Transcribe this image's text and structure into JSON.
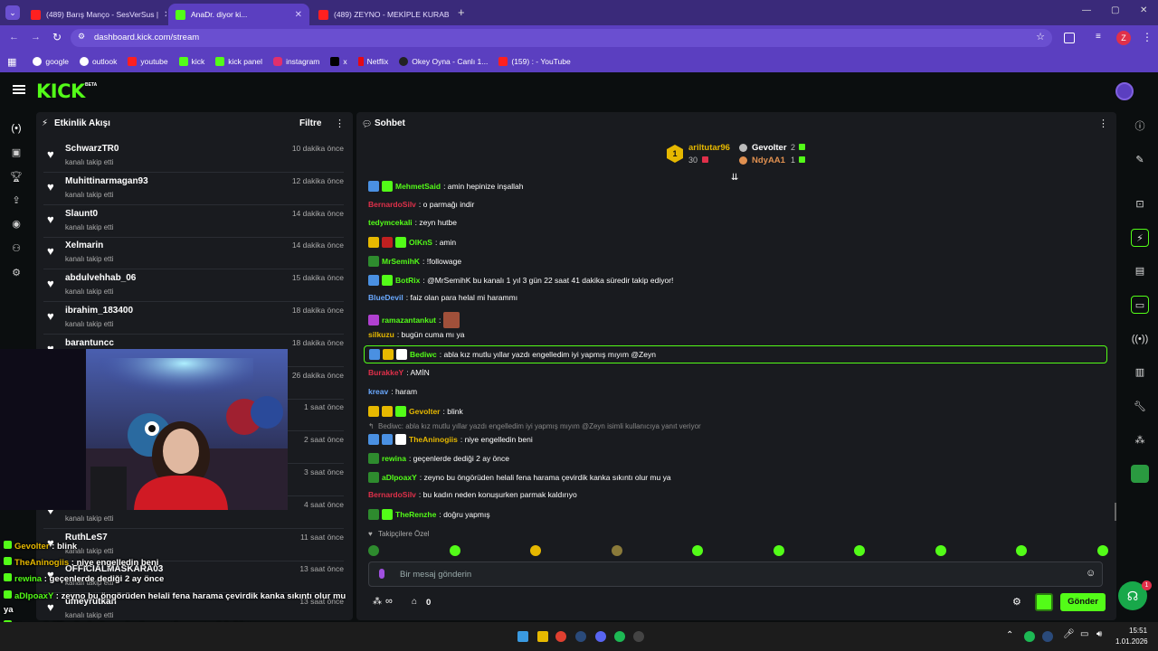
{
  "browser": {
    "tabs": [
      {
        "title": "(489) Barış Manço - SesVerSus |",
        "icon_color": "#ff2020"
      },
      {
        "title": "AnaDr. diyor ki...",
        "icon_color": "#53fc18"
      },
      {
        "title": "(489) ZEYNO - MEKİPLE KURAB",
        "icon_color": "#ff2020"
      }
    ],
    "url": "dashboard.kick.com/stream",
    "profile_initial": "Z",
    "bookmarks": [
      {
        "label": "google",
        "color": "#ffffff"
      },
      {
        "label": "outlook",
        "color": "#ffffff"
      },
      {
        "label": "youtube",
        "color": "#ff2020"
      },
      {
        "label": "kick",
        "color": "#53fc18"
      },
      {
        "label": "kick panel",
        "color": "#53fc18"
      },
      {
        "label": "instagram",
        "color": "#e1306c"
      },
      {
        "label": "x",
        "color": "#000000"
      },
      {
        "label": "Netflix",
        "color": "#e50914"
      },
      {
        "label": "Okey Oyna - Canlı 1...",
        "color": "#222222"
      },
      {
        "label": "(159) : - YouTube",
        "color": "#ff2020"
      }
    ]
  },
  "kick": {
    "logo": "KICK",
    "beta": "BETA",
    "accent": "#53fc18"
  },
  "activity": {
    "title": "Etkinlik Akışı",
    "filter": "Filtre",
    "items": [
      {
        "name": "SchwarzTR0",
        "sub": "kanalı takip etti",
        "time": "10 dakika önce"
      },
      {
        "name": "Muhittinarmagan93",
        "sub": "kanalı takip etti",
        "time": "12 dakika önce"
      },
      {
        "name": "Slaunt0",
        "sub": "kanalı takip etti",
        "time": "14 dakika önce"
      },
      {
        "name": "Xelmarin",
        "sub": "kanalı takip etti",
        "time": "14 dakika önce"
      },
      {
        "name": "abdulvehhab_06",
        "sub": "kanalı takip etti",
        "time": "15 dakika önce"
      },
      {
        "name": "ibrahim_183400",
        "sub": "kanalı takip etti",
        "time": "18 dakika önce"
      },
      {
        "name": "barantuncc",
        "sub": "kanalı takip etti",
        "time": "18 dakika önce"
      },
      {
        "name": "",
        "sub": "",
        "time": "26 dakika önce"
      },
      {
        "name": "",
        "sub": "",
        "time": "1 saat önce"
      },
      {
        "name": "",
        "sub": "",
        "time": "2 saat önce"
      },
      {
        "name": "",
        "sub": "",
        "time": "3 saat önce"
      },
      {
        "name": "",
        "sub": "kanalı takip etti",
        "time": "4 saat önce"
      },
      {
        "name": "RuthLeS7",
        "sub": "kanalı takip etti",
        "time": "11 saat önce"
      },
      {
        "name": "OFFICIALMASKARA03",
        "sub": "kanalı takip etti",
        "time": "13 saat önce"
      },
      {
        "name": "umeyrutkan",
        "sub": "kanalı takip etti",
        "time": "13 saat önce"
      }
    ]
  },
  "chat": {
    "title": "Sohbet",
    "leaderboard": {
      "first": {
        "name": "ariltutar96",
        "rank": "1",
        "count": "30"
      },
      "second": {
        "name": "Gevolter",
        "count": "2"
      },
      "third": {
        "name": "NdyAA1",
        "count": "1"
      }
    },
    "messages": [
      {
        "user": "MehmetSaid",
        "color": "#53fc18",
        "text": ": amin hepinize inşallah",
        "badges": [
          "#4a90e2",
          "#53fc18"
        ]
      },
      {
        "user": "BernardoSilv",
        "color": "#e0304a",
        "text": ": o parmağı indir",
        "badges": []
      },
      {
        "user": "tedymcekali",
        "color": "#53fc18",
        "text": ": zeyn hutbe",
        "badges": []
      },
      {
        "user": "OlKnS",
        "color": "#53fc18",
        "text": ": amin",
        "badges": [
          "#e6b800",
          "#c02020",
          "#53fc18"
        ]
      },
      {
        "user": "MrSemihK",
        "color": "#53fc18",
        "text": ": !followage",
        "badges": [
          "#2e8b2e"
        ]
      },
      {
        "user": "BotRix",
        "color": "#53fc18",
        "text": ": @MrSemihK bu kanalı 1 yıl 3 gün 22 saat 41 dakika süredir takip ediyor!",
        "badges": [
          "#4a90e2",
          "#53fc18"
        ]
      },
      {
        "user": "BlueDevil",
        "color": "#6aa9ff",
        "text": ": faiz olan para helal mi harammı",
        "badges": []
      },
      {
        "user": "ramazantankut",
        "color": "#53fc18",
        "text": ":",
        "badges": [
          "#b040d0"
        ]
      },
      {
        "user": "silkuzu",
        "color": "#e6b800",
        "text": ": bugün cuma mı ya",
        "badges": []
      },
      {
        "user": "Bediwc",
        "color": "#53fc18",
        "text": ": abla kız mutlu yıllar yazdı engelledim iyi yapmış mıyım @Zeyn",
        "badges": [
          "#4a90e2",
          "#e6b800",
          "#ffffff"
        ]
      },
      {
        "user": "BurakkeY",
        "color": "#e0304a",
        "text": ": AMİN",
        "badges": []
      },
      {
        "user": "kreav",
        "color": "#6aa9ff",
        "text": ": haram",
        "badges": []
      },
      {
        "user": "Gevolter",
        "color": "#e6b800",
        "text": ": blink",
        "badges": [
          "#e6b800",
          "#e6b800",
          "#53fc18"
        ]
      },
      {
        "user": "TheAninogiis",
        "color": "#e6b800",
        "text": ": niye engelledin beni",
        "badges": [
          "#4a90e2",
          "#4a90e2",
          "#ffffff"
        ]
      },
      {
        "user": "rewina",
        "color": "#53fc18",
        "text": ": geçenlerde dediği 2 ay önce",
        "badges": [
          "#2e8b2e"
        ]
      },
      {
        "user": "aDIpoaxY",
        "color": "#53fc18",
        "text": ": zeyno bu öngörüden helali fena harama çevirdik kanka sıkıntı olur mu ya",
        "badges": [
          "#2e8b2e"
        ]
      },
      {
        "user": "BernardoSilv",
        "color": "#e0304a",
        "text": ": bu kadın neden konuşurken parmak kaldırıyo",
        "badges": []
      },
      {
        "user": "TheRenzhe",
        "color": "#53fc18",
        "text": ": doğru yapmış",
        "badges": [
          "#2e8b2e",
          "#53fc18"
        ]
      }
    ],
    "reply_note": "Bediwc: abla kız mutlu yıllar yazdı engelledim iyi yapmış mıyım @Zeyn isimli kullanıcıya yanıt veriyor",
    "followers_label": "Takipçilere Özel",
    "input_placeholder": "Bir mesaj gönderin",
    "send_label": "Gönder",
    "footer_count": "0"
  },
  "overlay": [
    {
      "user": "Gevolter",
      "color": "#e6b800",
      "text": " : blink"
    },
    {
      "user": "TheAninogiis",
      "color": "#e6b800",
      "text": " : niye engelledin beni"
    },
    {
      "user": "rewina",
      "color": "#53fc18",
      "text": " : geçenlerde dediği 2 ay önce"
    },
    {
      "user": "aDIpoaxY",
      "color": "#53fc18",
      "text": " : zeyno bu öngörüden helali fena harama çevirdik kanka sıkıntı olur mu"
    },
    {
      "user": "",
      "color": "#ffffff",
      "text": "ya"
    },
    {
      "user": "BernardoSilv",
      "color": "#e0304a",
      "text": " : bu kadın neden konuşurken parmak kaldırıyo"
    },
    {
      "user": "TheRenzhe",
      "color": "#53fc18",
      "text": " : doğru yapmış"
    }
  ],
  "taskbar": {
    "time": "15:51",
    "date": "1.01.2026"
  },
  "notif_count": "1"
}
